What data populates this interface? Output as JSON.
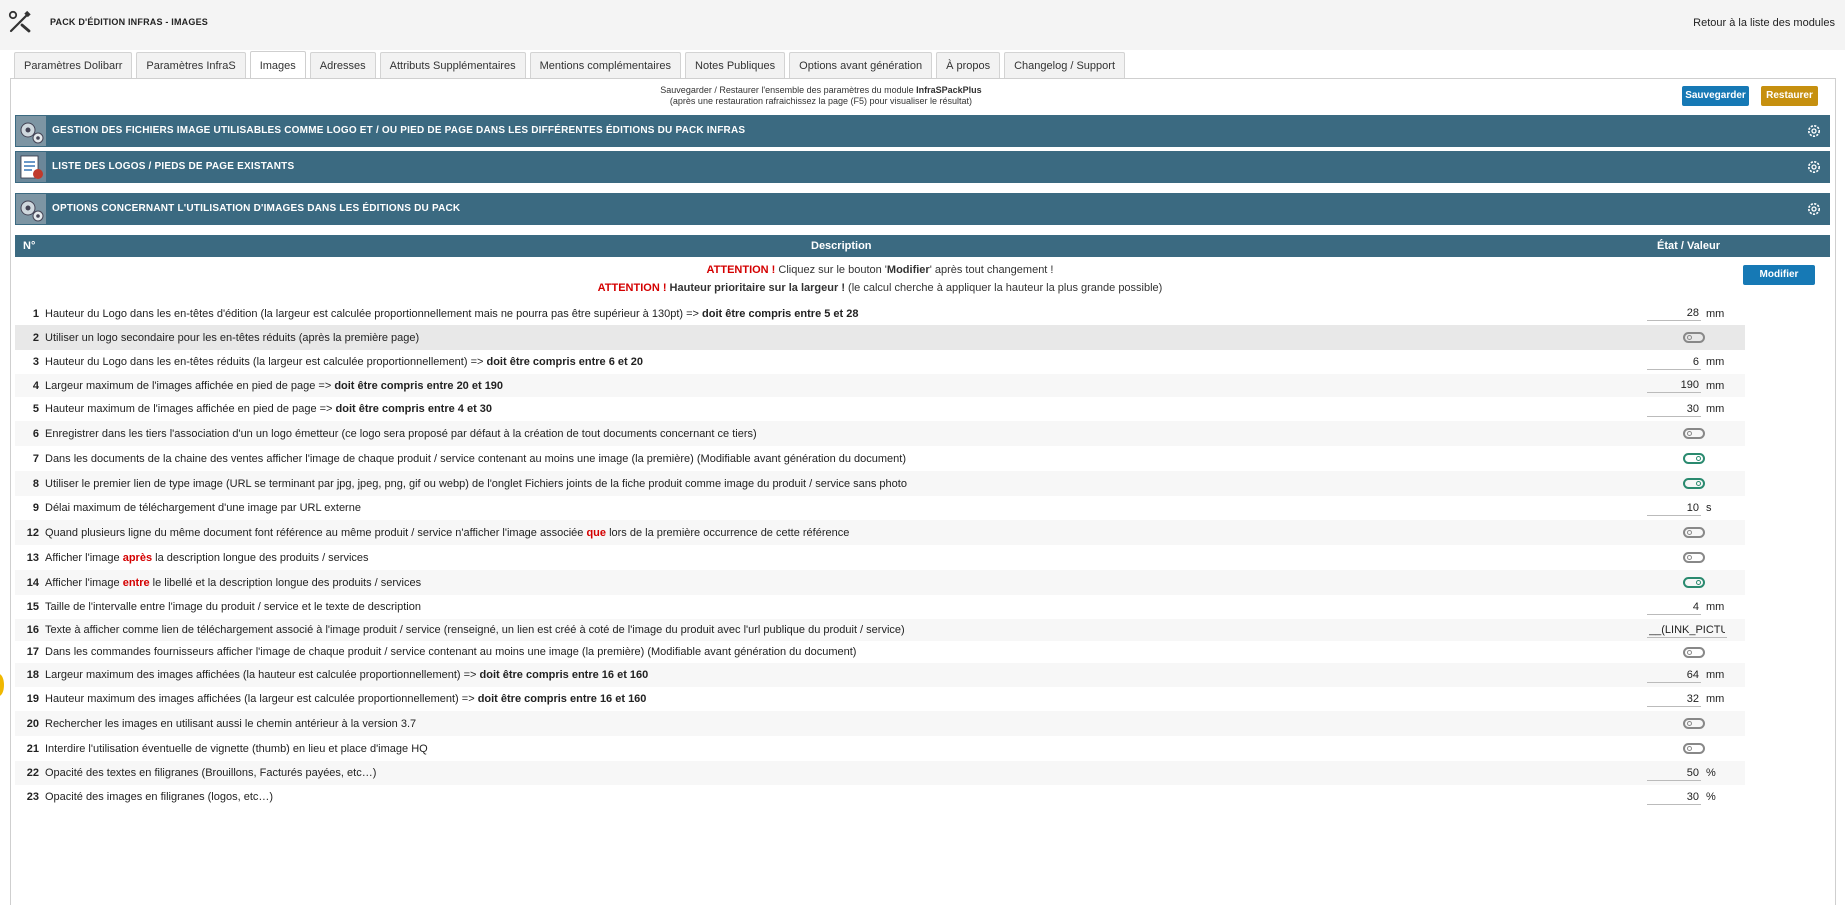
{
  "header": {
    "title": "PACK D'ÉDITION INFRAS - IMAGES",
    "back_link": "Retour à la liste des modules"
  },
  "tabs": [
    {
      "label": "Paramètres Dolibarr",
      "active": false
    },
    {
      "label": "Paramètres InfraS",
      "active": false
    },
    {
      "label": "Images",
      "active": true
    },
    {
      "label": "Adresses",
      "active": false
    },
    {
      "label": "Attributs Supplémentaires",
      "active": false
    },
    {
      "label": "Mentions complémentaires",
      "active": false
    },
    {
      "label": "Notes Publiques",
      "active": false
    },
    {
      "label": "Options avant génération",
      "active": false
    },
    {
      "label": "À propos",
      "active": false
    },
    {
      "label": "Changelog / Support",
      "active": false
    }
  ],
  "save": {
    "line1_pre": "Sauvegarder / Restaurer l'ensemble des paramètres du module ",
    "line1_module": "InfraSPackPlus",
    "line2": "(après une restauration rafraichissez la page (F5) pour visualiser le résultat)",
    "save_label": "Sauvegarder",
    "restore_label": "Restaurer"
  },
  "sections": [
    {
      "title": "Gestion des fichiers image utilisables comme logo et / ou pied de page dans les différentes éditions du pack InfraS",
      "icon": "gears-icon"
    },
    {
      "title": "Liste des logos / pieds de page existants",
      "icon": "document-list-icon"
    },
    {
      "title": "Options concernant l'utilisation d'images dans les éditions du pack",
      "icon": "gears-icon"
    }
  ],
  "table": {
    "col_num": "N°",
    "col_desc": "Description",
    "col_value": "État / Valeur",
    "modify_label": "Modifier",
    "attn1": {
      "label": "ATTENTION !",
      "pre": " Cliquez sur le bouton '",
      "bold": "Modifier",
      "post": "' après tout changement !"
    },
    "attn2": {
      "label": "ATTENTION !",
      "bold": " Hauteur prioritaire sur la largeur !",
      "post": " (le calcul cherche à appliquer la hauteur la plus grande possible)"
    }
  },
  "rows": [
    {
      "num": "1",
      "text": "Hauteur du Logo dans les en-têtes d'édition (la largeur est calculée proportionnellement mais ne pourra pas être supérieur à 130pt) => ",
      "bold": "doit être compris entre 5 et 28",
      "kind": "number",
      "value": "28",
      "unit": "mm"
    },
    {
      "num": "2",
      "text": "Utiliser un logo secondaire pour les en-têtes réduits (après la première page)",
      "kind": "toggle",
      "on": false
    },
    {
      "num": "3",
      "text": "Hauteur du Logo dans les en-têtes réduits (la largeur est calculée proportionnellement) => ",
      "bold": "doit être compris entre 6 et 20",
      "kind": "number",
      "value": "6",
      "unit": "mm"
    },
    {
      "num": "4",
      "text": "Largeur maximum de l'images affichée en pied de page => ",
      "bold": "doit être compris entre 20 et 190",
      "kind": "number",
      "value": "190",
      "unit": "mm"
    },
    {
      "num": "5",
      "text": "Hauteur maximum de l'images affichée en pied de page => ",
      "bold": "doit être compris entre 4 et 30",
      "kind": "number",
      "value": "30",
      "unit": "mm"
    },
    {
      "num": "6",
      "text": "Enregistrer dans les tiers l'association d'un un logo émetteur (ce logo sera proposé par défaut à la création de tout documents concernant ce tiers)",
      "kind": "toggle",
      "on": false
    },
    {
      "num": "7",
      "text": "Dans les documents de la chaine des ventes afficher l'image de chaque produit / service contenant au moins une image (la première) (Modifiable avant génération du document)",
      "kind": "toggle",
      "on": true
    },
    {
      "num": "8",
      "text": "Utiliser le premier lien de type image (URL se terminant par jpg, jpeg, png, gif ou webp) de l'onglet Fichiers joints de la fiche produit comme image du produit / service sans photo",
      "kind": "toggle",
      "on": true
    },
    {
      "num": "9",
      "text": "Délai maximum de téléchargement d'une image par URL externe",
      "kind": "number",
      "value": "10",
      "unit": "s"
    },
    {
      "num": "12",
      "text": "Quand plusieurs ligne du même document font référence au même produit / service n'afficher l'image associée ",
      "red": "que",
      "post": " lors de la première occurrence de cette référence",
      "kind": "toggle",
      "on": false
    },
    {
      "num": "13",
      "text": "Afficher l'image ",
      "red": "après",
      "post": " la description longue des produits / services",
      "kind": "toggle",
      "on": false
    },
    {
      "num": "14",
      "text": "Afficher l'image ",
      "red": "entre",
      "post": " le libellé et la description longue des produits / services",
      "kind": "toggle",
      "on": true
    },
    {
      "num": "15",
      "text": "Taille de l'intervalle entre l'image du produit / service et le texte de description",
      "kind": "number",
      "value": "4",
      "unit": "mm"
    },
    {
      "num": "16",
      "text": "Texte à afficher comme lien de téléchargement associé à l'image produit / service (renseigné, un lien est créé à coté de l'image du produit avec l'url publique du produit / service)",
      "kind": "text",
      "value": "__(LINK_PICTU"
    },
    {
      "num": "17",
      "text": "Dans les commandes fournisseurs afficher l'image de chaque produit / service contenant au moins une image (la première) (Modifiable avant génération du document)",
      "kind": "toggle",
      "on": false
    },
    {
      "num": "18",
      "text": "Largeur maximum des images affichées (la hauteur est calculée proportionnellement) => ",
      "bold": "doit être compris entre 16 et 160",
      "kind": "number",
      "value": "64",
      "unit": "mm"
    },
    {
      "num": "19",
      "text": "Hauteur maximum des images affichées (la largeur est calculée proportionnellement) => ",
      "bold": "doit être compris entre 16 et 160",
      "kind": "number",
      "value": "32",
      "unit": "mm"
    },
    {
      "num": "20",
      "text": "Rechercher les images en utilisant aussi le chemin antérieur à la version 3.7",
      "kind": "toggle",
      "on": false
    },
    {
      "num": "21",
      "text": "Interdire l'utilisation éventuelle de vignette (thumb) en lieu et place d'image HQ",
      "kind": "toggle",
      "on": false
    },
    {
      "num": "22",
      "text": "Opacité des textes en filigranes (Brouillons, Facturés payées, etc…)",
      "kind": "number",
      "value": "50",
      "unit": "%"
    },
    {
      "num": "23",
      "text": "Opacité des images en filigranes (logos, etc…)",
      "kind": "number",
      "value": "30",
      "unit": "%"
    }
  ]
}
